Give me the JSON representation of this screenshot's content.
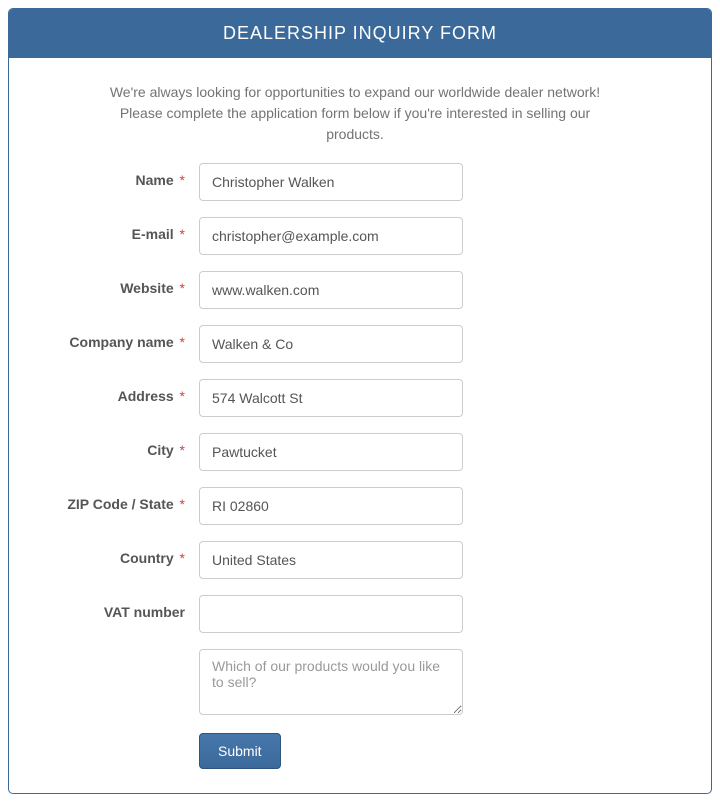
{
  "header": {
    "title": "DEALERSHIP INQUIRY FORM"
  },
  "intro": "We're always looking for opportunities to expand our worldwide dealer network! Please complete the application form below if you're interested in selling our products.",
  "fields": {
    "name": {
      "label": "Name",
      "required": true,
      "value": "Christopher Walken"
    },
    "email": {
      "label": "E-mail",
      "required": true,
      "value": "christopher@example.com"
    },
    "website": {
      "label": "Website",
      "required": true,
      "value": "www.walken.com"
    },
    "company": {
      "label": "Company name",
      "required": true,
      "value": "Walken & Co"
    },
    "address": {
      "label": "Address",
      "required": true,
      "value": "574 Walcott St"
    },
    "city": {
      "label": "City",
      "required": true,
      "value": "Pawtucket"
    },
    "zipstate": {
      "label": "ZIP Code / State",
      "required": true,
      "value": "RI 02860"
    },
    "country": {
      "label": "Country",
      "required": true,
      "value": "United States"
    },
    "vat": {
      "label": "VAT number",
      "required": false,
      "value": ""
    },
    "message": {
      "label": "",
      "required": false,
      "value": "",
      "placeholder": "Which of our products would you like to sell?"
    }
  },
  "required_mark": "*",
  "submit": {
    "label": "Submit"
  }
}
